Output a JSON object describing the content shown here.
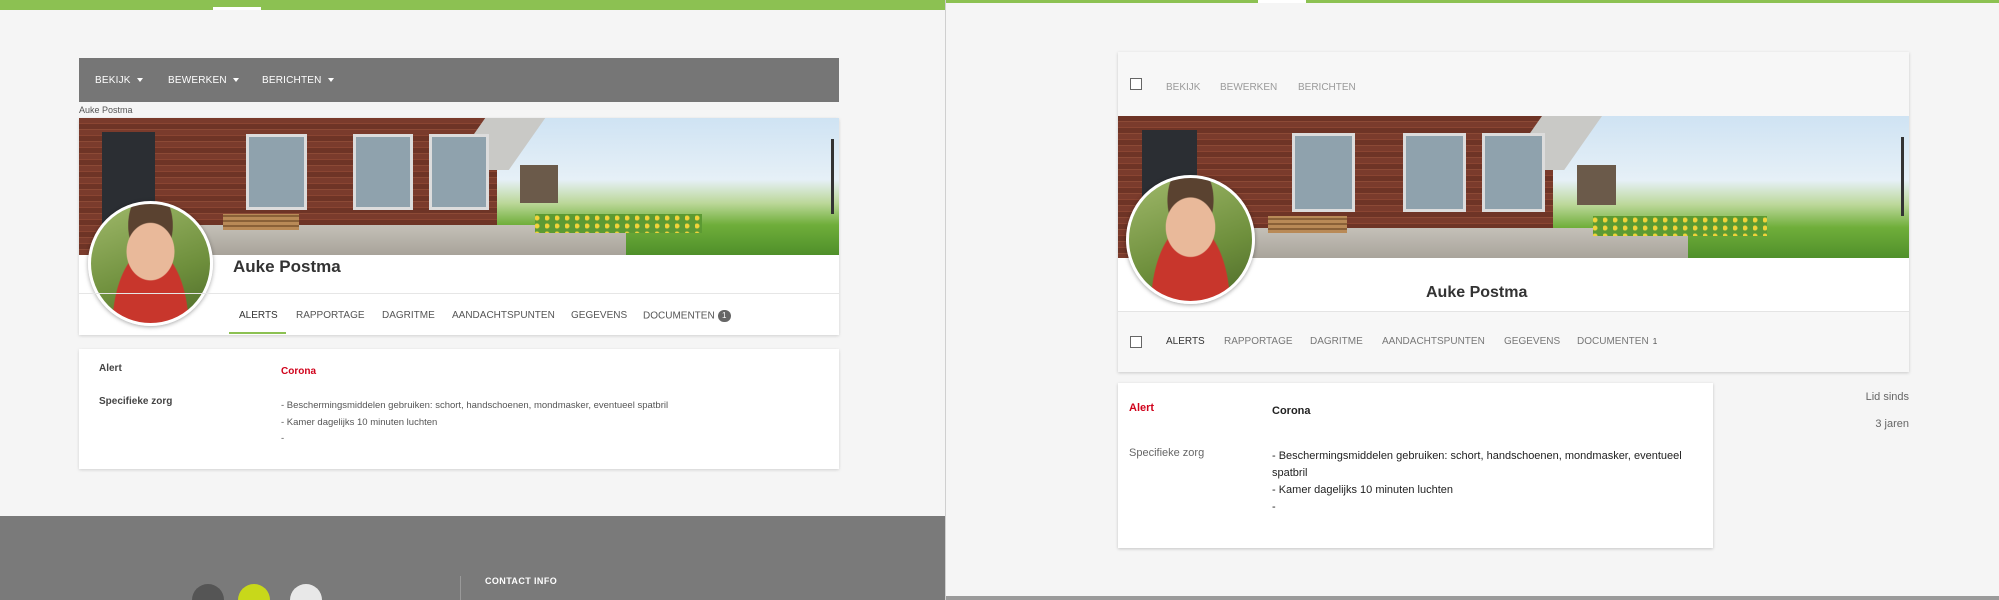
{
  "left": {
    "menu": [
      {
        "label": "BEKIJK"
      },
      {
        "label": "BEWERKEN"
      },
      {
        "label": "BERICHTEN"
      }
    ],
    "breadcrumb": "Auke Postma",
    "profile_name": "Auke Postma",
    "tabs": [
      {
        "label": "ALERTS"
      },
      {
        "label": "RAPPORTAGE"
      },
      {
        "label": "DAGRITME"
      },
      {
        "label": "AANDACHTSPUNTEN"
      },
      {
        "label": "GEGEVENS"
      },
      {
        "label": "DOCUMENTEN",
        "badge": "1"
      }
    ],
    "alert_label": "Alert",
    "alert_value": "Corona",
    "care_label": "Specifieke zorg",
    "care_lines": [
      "- Beschermingsmiddelen gebruiken: schort, handschoenen, mondmasker, eventueel spatbril",
      "- Kamer dagelijks 10 minuten luchten",
      "-"
    ],
    "footer": {
      "contact_title": "CONTACT INFO"
    }
  },
  "right": {
    "toolbar": [
      {
        "label": "BEKIJK"
      },
      {
        "label": "BEWERKEN"
      },
      {
        "label": "BERICHTEN"
      }
    ],
    "profile_name": "Auke Postma",
    "tabs": [
      {
        "label": "ALERTS"
      },
      {
        "label": "RAPPORTAGE"
      },
      {
        "label": "DAGRITME"
      },
      {
        "label": "AANDACHTSPUNTEN"
      },
      {
        "label": "GEGEVENS"
      },
      {
        "label": "DOCUMENTEN",
        "count": "1"
      }
    ],
    "alert_label": "Alert",
    "alert_value": "Corona",
    "care_label": "Specifieke zorg",
    "care_lines": [
      "- Beschermingsmiddelen gebruiken: schort, handschoenen, mondmasker, eventueel",
      "spatbril",
      "- Kamer dagelijks 10 minuten luchten",
      "-"
    ],
    "member_since_label": "Lid sinds",
    "member_since_value": "3 jaren"
  },
  "colors": {
    "accent": "#8cc152",
    "alert": "#d0021b",
    "menubar": "#767676"
  }
}
